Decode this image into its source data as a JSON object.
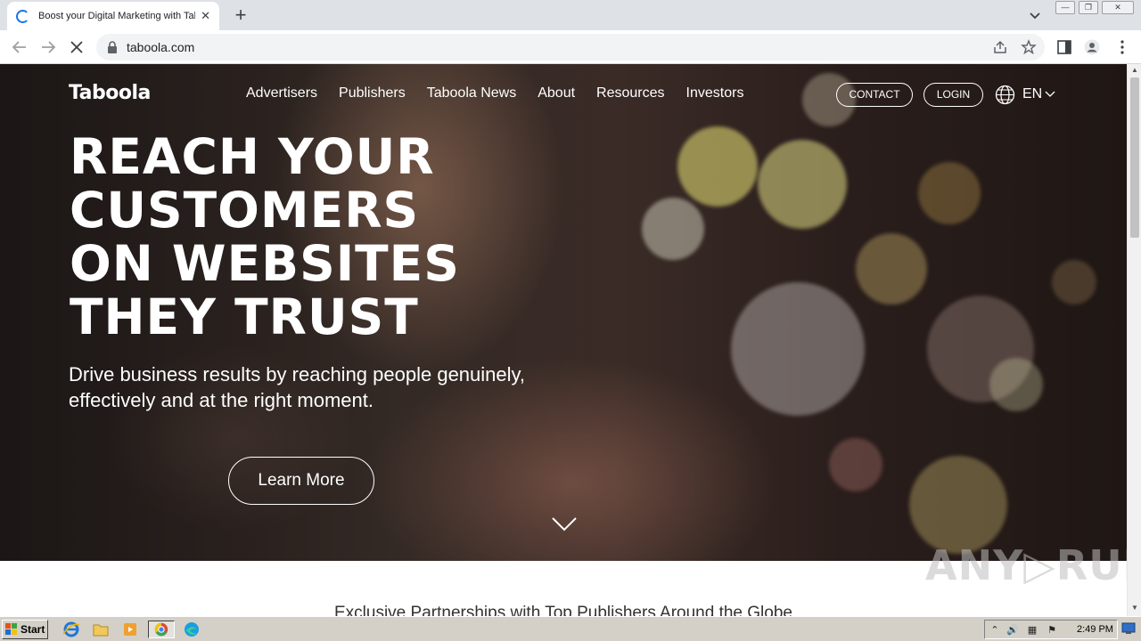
{
  "browser": {
    "tab_title": "Boost your Digital Marketing with Taboola",
    "tab_close": "✕",
    "new_tab": "+",
    "url": "taboola.com",
    "window_buttons": [
      "—",
      "❐",
      "✕"
    ]
  },
  "site": {
    "logo": "Taboola",
    "nav": [
      "Advertisers",
      "Publishers",
      "Taboola News",
      "About",
      "Resources",
      "Investors"
    ],
    "contact_label": "CONTACT",
    "login_label": "LOGIN",
    "language": "EN"
  },
  "hero": {
    "headline_lines": [
      "REACH YOUR",
      "CUSTOMERS",
      "ON WEBSITES",
      "THEY TRUST"
    ],
    "subline": "Drive business results by reaching people genuinely, effectively and at the right moment.",
    "cta": "Learn More"
  },
  "section": {
    "partners_heading": "Exclusive Partnerships with Top Publishers Around the Globe"
  },
  "watermark": "ANY RUN",
  "taskbar": {
    "start_label": "Start",
    "apps": [
      "internet-explorer-icon",
      "folder-icon",
      "media-player-icon",
      "chrome-icon",
      "edge-icon"
    ],
    "clock": "2:49 PM"
  },
  "colors": {
    "chrome_tab_bar": "#dee1e6",
    "accent_blue": "#1a73e8",
    "hero_text": "#ffffff",
    "taskbar": "#d4d0c8"
  }
}
